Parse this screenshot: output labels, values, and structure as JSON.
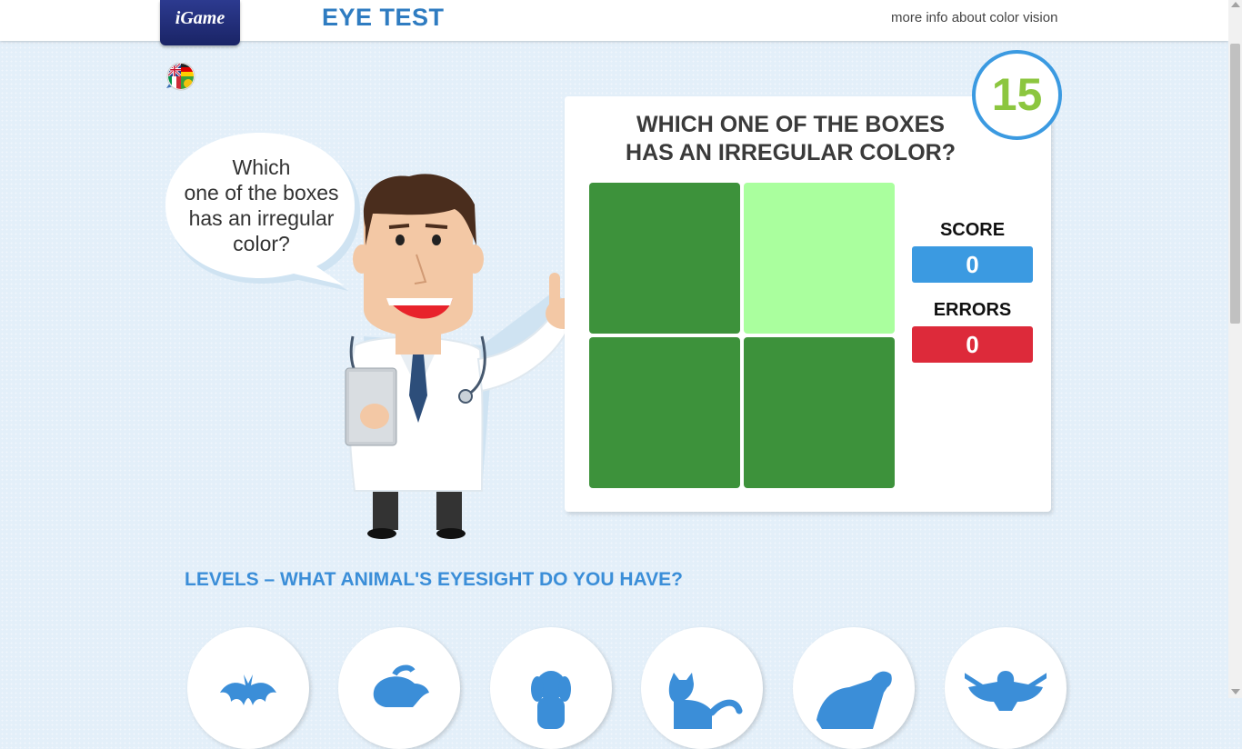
{
  "header": {
    "logo_text": "iGame",
    "title": "EYE TEST",
    "more_info_link": "more info about color vision"
  },
  "language_icon": "language-flags-icon",
  "bubble": {
    "text": "Which\none of the boxes\nhas an irregular\ncolor?"
  },
  "game": {
    "question_line1": "WHICH ONE OF THE BOXES",
    "question_line2": "HAS AN IRREGULAR COLOR?",
    "timer": "15",
    "boxes": [
      {
        "color": "#3d923b"
      },
      {
        "color": "#aaff9e"
      },
      {
        "color": "#3d923b"
      },
      {
        "color": "#3d923b"
      }
    ],
    "score_label": "SCORE",
    "score_value": "0",
    "errors_label": "ERRORS",
    "errors_value": "0"
  },
  "levels": {
    "title": "LEVELS – WHAT ANIMAL'S EYESIGHT DO YOU HAVE?",
    "items": [
      {
        "icon": "bat-icon"
      },
      {
        "icon": "mole-icon"
      },
      {
        "icon": "dog-icon"
      },
      {
        "icon": "cat-icon"
      },
      {
        "icon": "tiger-icon"
      },
      {
        "icon": "eagle-icon"
      }
    ]
  },
  "colors": {
    "accent_blue": "#3b9ae1",
    "title_blue": "#2f7cc1",
    "timer_green": "#8cc63f",
    "score_bg": "#3b9ae1",
    "errors_bg": "#dd2a3a",
    "icon_blue": "#3b8ed8"
  }
}
